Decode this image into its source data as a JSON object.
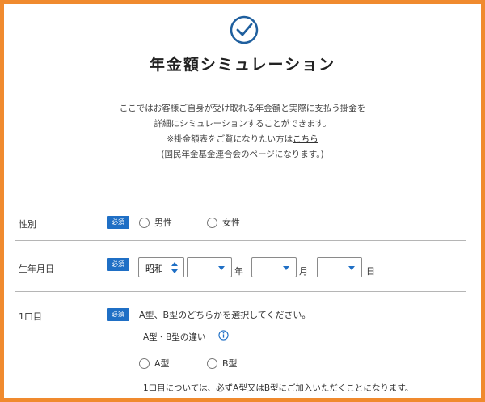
{
  "header": {
    "title": "年金額シミュレーション",
    "intro_line1": "ここではお客様ご自身が受け取れる年金額と実際に支払う掛金を",
    "intro_line2": "詳細にシミュレーションすることができます。",
    "intro_line3_prefix": "※掛金額表をご覧になりたい方は",
    "intro_link": "こちら",
    "intro_line4": "(国民年金基金連合会のページになります。)"
  },
  "colors": {
    "frame": "#f08a2e",
    "accent": "#1f6fc5",
    "check_icon": "#1f5f9e"
  },
  "form": {
    "required_badge": "必須",
    "gender": {
      "label": "性別",
      "options": [
        "男性",
        "女性"
      ]
    },
    "birthdate": {
      "label": "生年月日",
      "era_value": "昭和",
      "year_suffix": "年",
      "month_suffix": "月",
      "day_suffix": "日"
    },
    "first_unit": {
      "label": "1口目",
      "instruction_a": "A型",
      "instruction_sep": "、",
      "instruction_b": "B型",
      "instruction_rest": "のどちらかを選択してください。",
      "difference_label": "A型・B型の違い",
      "options": [
        "A型",
        "B型"
      ],
      "note": "1口目については、必ずA型又はB型にご加入いただくことになります。"
    }
  },
  "icons": {
    "check": "check-circle-icon",
    "info": "info-icon",
    "caret": "chevron-down-icon"
  }
}
